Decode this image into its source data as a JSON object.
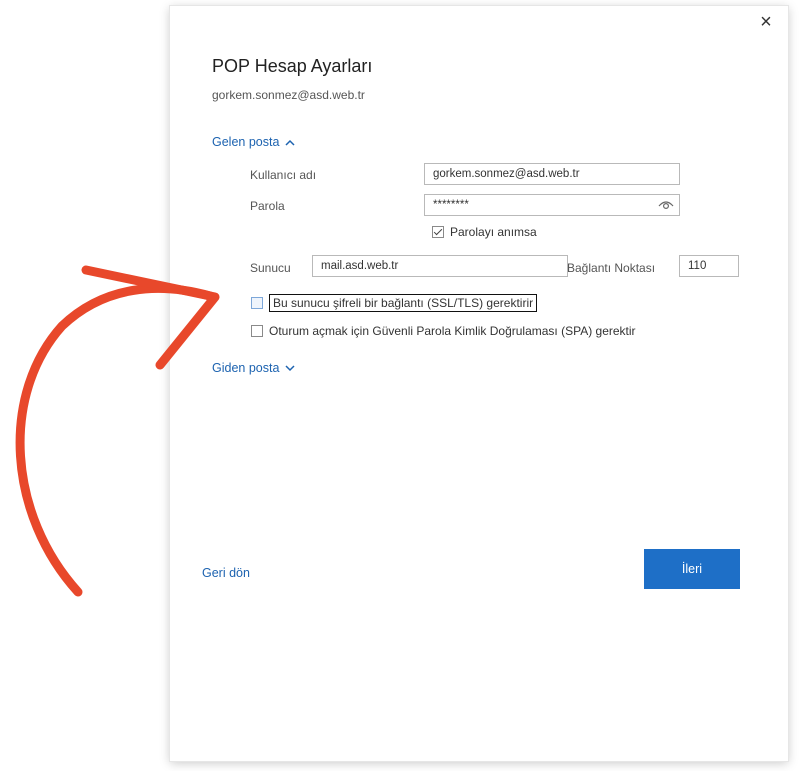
{
  "dialog": {
    "close_label": "×",
    "title": "POP Hesap Ayarları",
    "account_email": "gorkem.sonmez@asd.web.tr"
  },
  "incoming": {
    "header": "Gelen posta",
    "chevron_icon": "chevron-up-icon",
    "username_label": "Kullanıcı adı",
    "username_value": "gorkem.sonmez@asd.web.tr",
    "password_label": "Parola",
    "password_value": "********",
    "remember_label": "Parolayı anımsa",
    "remember_checked": true,
    "server_label": "Sunucu",
    "server_value": "mail.asd.web.tr",
    "port_label": "Bağlantı Noktası",
    "port_value": "110",
    "ssl_label": "Bu sunucu şifreli bir bağlantı (SSL/TLS) gerektirir",
    "ssl_checked": false,
    "spa_label": "Oturum açmak için Güvenli Parola Kimlik Doğrulaması (SPA) gerektir",
    "spa_checked": false
  },
  "outgoing": {
    "header": "Giden posta",
    "chevron_icon": "chevron-down-icon"
  },
  "footer": {
    "back_label": "Geri dön",
    "next_label": "İleri"
  },
  "colors": {
    "accent": "#1e6fc7",
    "link": "#1d63b0",
    "annotation_arrow": "#e8482b"
  }
}
